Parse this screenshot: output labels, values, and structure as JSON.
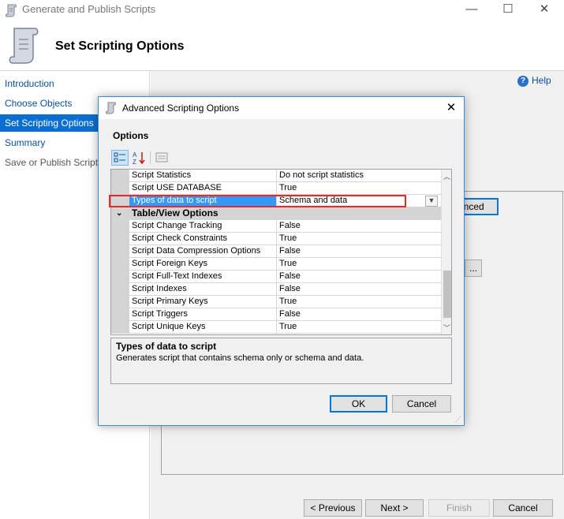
{
  "window": {
    "title": "Generate and Publish Scripts",
    "minimize": "—",
    "maximize": "☐",
    "close": "✕"
  },
  "header": {
    "title": "Set Scripting Options"
  },
  "nav": {
    "items": [
      {
        "label": "Introduction"
      },
      {
        "label": "Choose Objects"
      },
      {
        "label": "Set Scripting Options"
      },
      {
        "label": "Summary"
      },
      {
        "label": "Save or Publish Scripts"
      }
    ]
  },
  "content": {
    "help_label": "Help",
    "advanced_partial": "anced",
    "browse_label": "..."
  },
  "footer": {
    "previous": "< Previous",
    "next": "Next >",
    "finish": "Finish",
    "cancel": "Cancel"
  },
  "dialog": {
    "title": "Advanced Scripting Options",
    "close": "✕",
    "options_label": "Options",
    "rows": [
      {
        "name": "Script Statistics",
        "value": "Do not script statistics"
      },
      {
        "name": "Script USE DATABASE",
        "value": "True"
      },
      {
        "name": "Types of data to script",
        "value": "Schema and data"
      },
      {
        "name": "Table/View Options",
        "value": ""
      },
      {
        "name": "Script Change Tracking",
        "value": "False"
      },
      {
        "name": "Script Check Constraints",
        "value": "True"
      },
      {
        "name": "Script Data Compression Options",
        "value": "False"
      },
      {
        "name": "Script Foreign Keys",
        "value": "True"
      },
      {
        "name": "Script Full-Text Indexes",
        "value": "False"
      },
      {
        "name": "Script Indexes",
        "value": "False"
      },
      {
        "name": "Script Primary Keys",
        "value": "True"
      },
      {
        "name": "Script Triggers",
        "value": "False"
      },
      {
        "name": "Script Unique Keys",
        "value": "True"
      }
    ],
    "description": {
      "title": "Types of data to script",
      "text": "Generates script that contains schema only or schema and data."
    },
    "ok": "OK",
    "cancel": "Cancel"
  },
  "colors": {
    "accent": "#0078d7",
    "selection": "#3399ff",
    "highlight_border": "#e8282b"
  }
}
